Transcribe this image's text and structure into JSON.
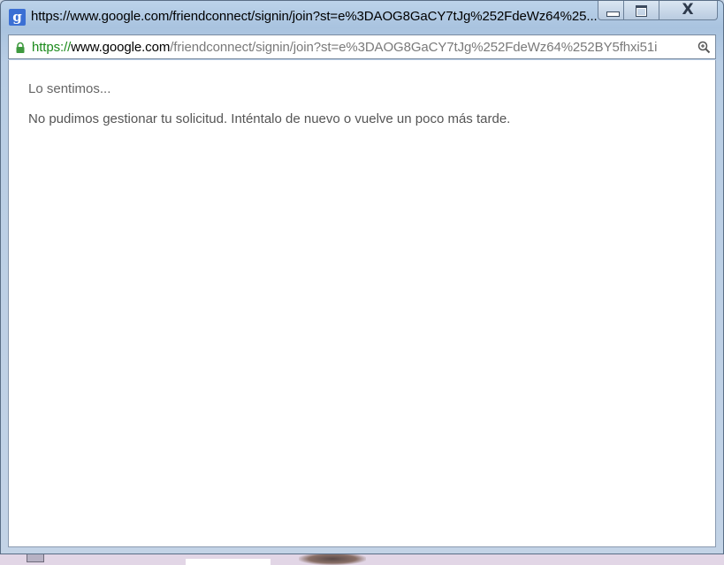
{
  "window": {
    "title": "https://www.google.com/friendconnect/signin/join?st=e%3DAOG8GaCY7tJg%252FdeWz64%25...",
    "app_icon_letter": "g",
    "close_glyph": "X"
  },
  "address_bar": {
    "url_scheme": "https://",
    "url_domain": "www.google.com",
    "url_path": "/friendconnect/signin/join?st=e%3DAOG8GaCY7tJg%252FdeWz64%252BY5fhxi51i"
  },
  "page": {
    "heading": "Lo sentimos...",
    "message": "No pudimos gestionar tu solicitud. Inténtalo de nuevo o vuelve un poco más tarde."
  },
  "colors": {
    "secure_scheme": "#1a8a1a",
    "lock": "#3f9a3f",
    "app_icon_bg": "#3a6fd4",
    "text_gray": "#666666"
  },
  "icons": {
    "app": "google-g-icon",
    "lock": "lock-icon",
    "zoom": "zoom-icon",
    "minimize": "minimize-icon",
    "maximize": "maximize-icon",
    "close": "close-icon"
  }
}
